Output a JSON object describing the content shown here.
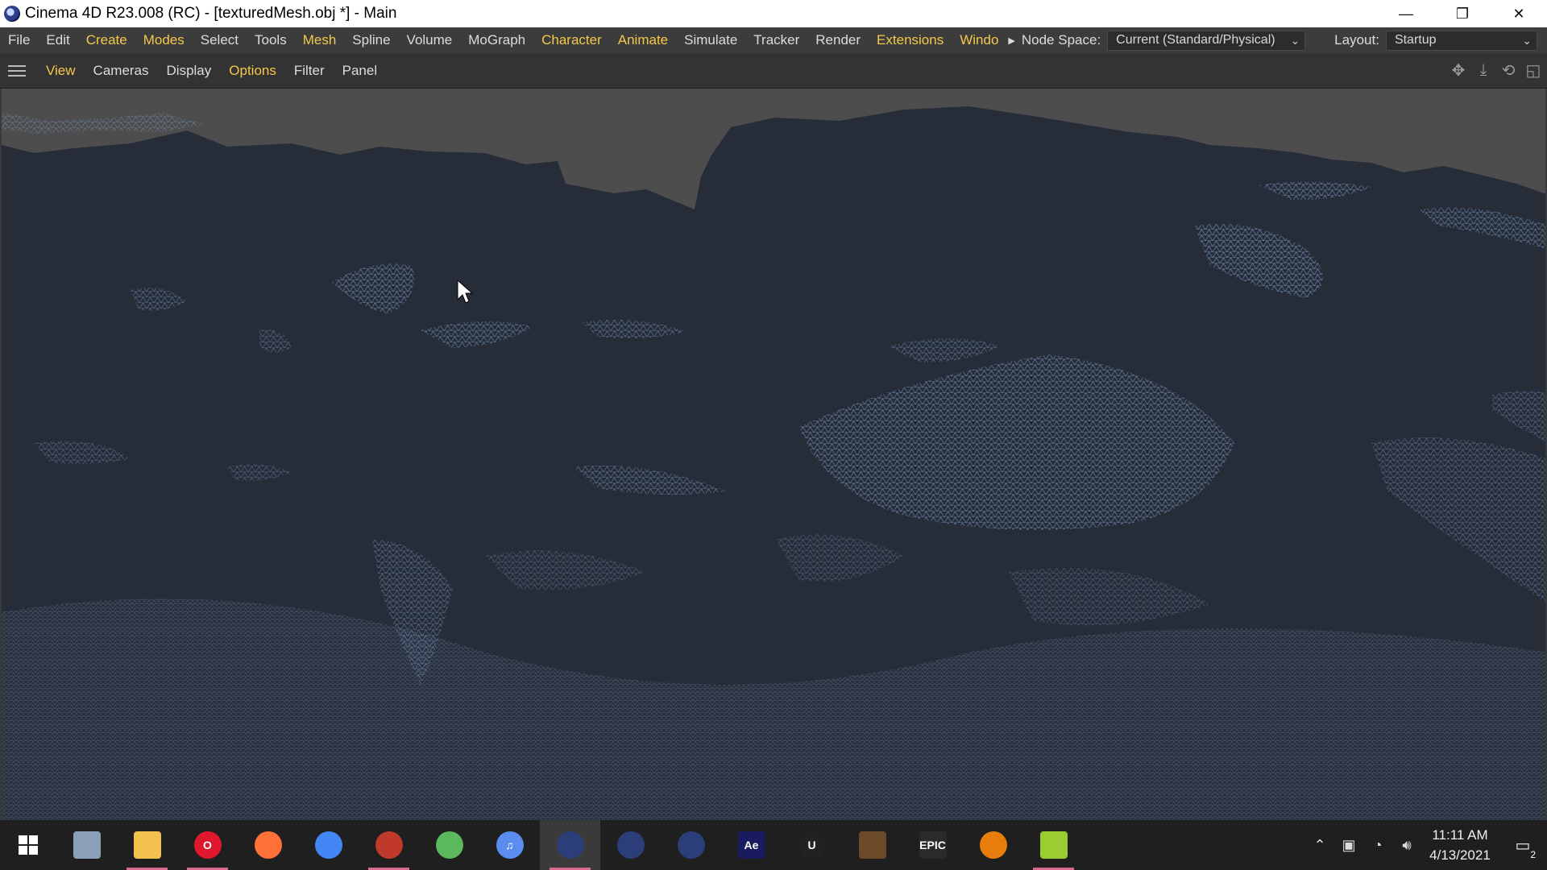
{
  "window": {
    "title": "Cinema 4D R23.008 (RC) - [texturedMesh.obj *] - Main",
    "minimize_glyph": "—",
    "restore_glyph": "❐",
    "close_glyph": "✕"
  },
  "menubar": {
    "items": [
      {
        "label": "File",
        "highlight": false
      },
      {
        "label": "Edit",
        "highlight": false
      },
      {
        "label": "Create",
        "highlight": true
      },
      {
        "label": "Modes",
        "highlight": true
      },
      {
        "label": "Select",
        "highlight": false
      },
      {
        "label": "Tools",
        "highlight": false
      },
      {
        "label": "Mesh",
        "highlight": true
      },
      {
        "label": "Spline",
        "highlight": false
      },
      {
        "label": "Volume",
        "highlight": false
      },
      {
        "label": "MoGraph",
        "highlight": false
      },
      {
        "label": "Character",
        "highlight": true
      },
      {
        "label": "Animate",
        "highlight": true
      },
      {
        "label": "Simulate",
        "highlight": false
      },
      {
        "label": "Tracker",
        "highlight": false
      },
      {
        "label": "Render",
        "highlight": false
      },
      {
        "label": "Extensions",
        "highlight": true
      },
      {
        "label": "Windo",
        "highlight": true
      }
    ],
    "node_space_label": "Node Space:",
    "node_space_value": "Current (Standard/Physical)",
    "layout_label": "Layout:",
    "layout_value": "Startup"
  },
  "viewport_menu": {
    "items": [
      {
        "label": "View",
        "highlight": true
      },
      {
        "label": "Cameras",
        "highlight": false
      },
      {
        "label": "Display",
        "highlight": false
      },
      {
        "label": "Options",
        "highlight": true
      },
      {
        "label": "Filter",
        "highlight": false
      },
      {
        "label": "Panel",
        "highlight": false
      }
    ],
    "nav_icons": [
      "move-view-icon",
      "dolly-view-icon",
      "rotate-view-icon",
      "toggle-panel-icon"
    ]
  },
  "viewport": {
    "background_color": "#4d4d4d",
    "mesh_color": "#262d38",
    "wire_color": "#7d9bc8"
  },
  "taskbar": {
    "apps": [
      {
        "name": "system-app-icon",
        "label": "",
        "color": "#8aa0b8",
        "running": false,
        "active": false
      },
      {
        "name": "file-explorer-icon",
        "label": "",
        "color": "#f2c14e",
        "running": true,
        "active": false
      },
      {
        "name": "opera-icon",
        "label": "O",
        "color": "#e0182d",
        "running": true,
        "active": false
      },
      {
        "name": "firefox-icon",
        "label": "",
        "color": "#ff7139",
        "running": false,
        "active": false
      },
      {
        "name": "chrome-icon",
        "label": "",
        "color": "#4285f4",
        "running": false,
        "active": false
      },
      {
        "name": "media-player-icon",
        "label": "",
        "color": "#c0392b",
        "running": true,
        "active": false
      },
      {
        "name": "green-app-icon",
        "label": "",
        "color": "#5cb85c",
        "running": false,
        "active": false
      },
      {
        "name": "music-app-icon",
        "label": "♫",
        "color": "#5a8dee",
        "running": false,
        "active": false
      },
      {
        "name": "cinema4d-icon-1",
        "label": "",
        "color": "#2c3e7a",
        "running": true,
        "active": true
      },
      {
        "name": "cinema4d-icon-2",
        "label": "",
        "color": "#2c3e7a",
        "running": false,
        "active": false
      },
      {
        "name": "cinema4d-icon-3",
        "label": "",
        "color": "#2c3e7a",
        "running": false,
        "active": false
      },
      {
        "name": "after-effects-icon",
        "label": "Ae",
        "color": "#1a1a5e",
        "running": false,
        "active": false
      },
      {
        "name": "unreal-icon",
        "label": "U",
        "color": "#222222",
        "running": false,
        "active": false
      },
      {
        "name": "minecraft-icon",
        "label": "",
        "color": "#6b4a2a",
        "running": false,
        "active": false
      },
      {
        "name": "epic-games-icon",
        "label": "EPIC",
        "color": "#2a2a2a",
        "running": false,
        "active": false
      },
      {
        "name": "blender-icon",
        "label": "",
        "color": "#e87d0d",
        "running": false,
        "active": false
      },
      {
        "name": "yellow-green-app-icon",
        "label": "",
        "color": "#9acd32",
        "running": true,
        "active": false
      }
    ],
    "tray": {
      "time": "11:11 AM",
      "date": "4/13/2021",
      "notification_count": "2"
    }
  }
}
